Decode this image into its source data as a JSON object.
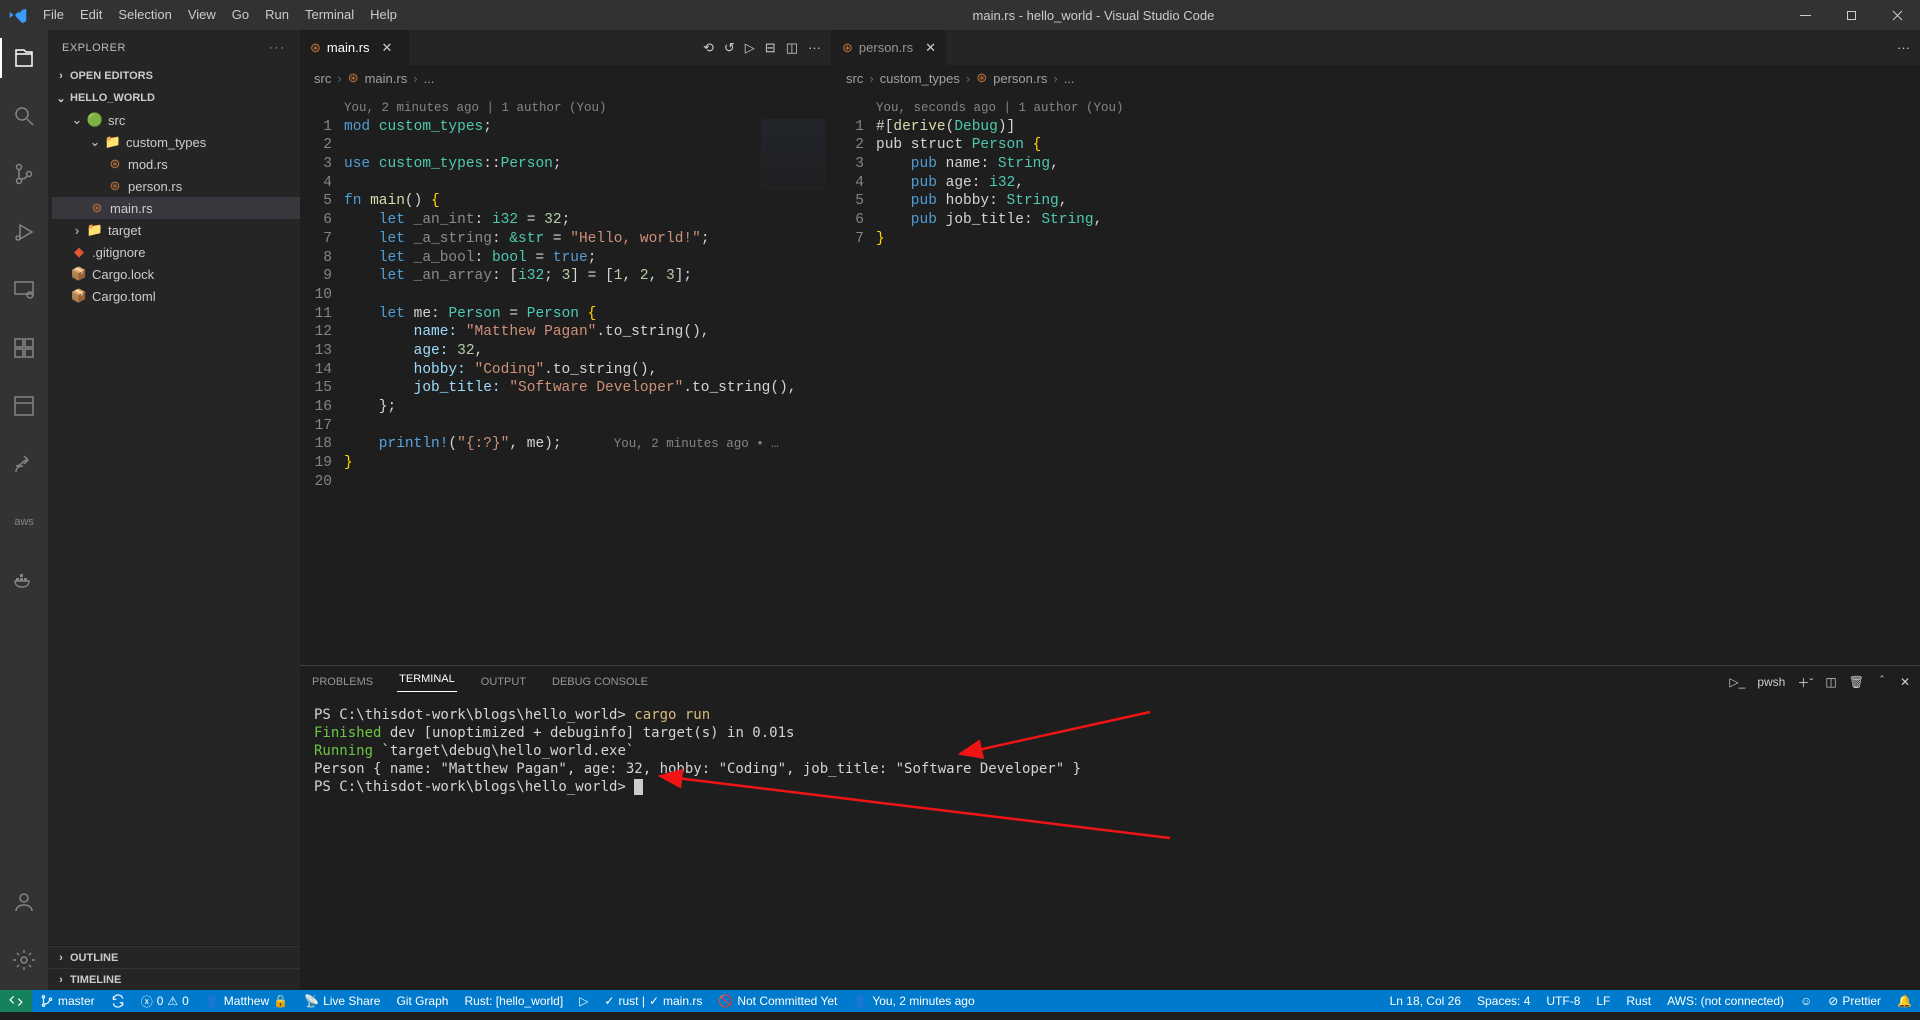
{
  "titlebar": {
    "title": "main.rs - hello_world - Visual Studio Code",
    "menus": [
      "File",
      "Edit",
      "Selection",
      "View",
      "Go",
      "Run",
      "Terminal",
      "Help"
    ]
  },
  "sidebar": {
    "title": "EXPLORER",
    "sections": {
      "openEditors": "OPEN EDITORS",
      "project": "HELLO_WORLD",
      "outline": "OUTLINE",
      "timeline": "TIMELINE"
    },
    "tree": {
      "src": "src",
      "custom_types": "custom_types",
      "mod_rs": "mod.rs",
      "person_rs": "person.rs",
      "main_rs": "main.rs",
      "target": "target",
      "gitignore": ".gitignore",
      "cargo_lock": "Cargo.lock",
      "cargo_toml": "Cargo.toml"
    }
  },
  "editor_left": {
    "tab_label": "main.rs",
    "breadcrumb": {
      "p1": "src",
      "p2": "main.rs",
      "p3": "..."
    },
    "codelens": "You, 2 minutes ago | 1 author (You)",
    "lines": {
      "1": [
        "mod ",
        "custom_types",
        ";"
      ],
      "2": "",
      "3": [
        "use ",
        "custom_types",
        "::",
        "Person",
        ";"
      ],
      "4": "",
      "5": [
        "fn ",
        "main",
        "() ",
        "{"
      ],
      "6": [
        "    let ",
        "_an_int",
        ": ",
        "i32",
        " = ",
        "32",
        ";"
      ],
      "7": [
        "    let ",
        "_a_string",
        ": ",
        "&str",
        " = ",
        "\"Hello, world!\"",
        ";"
      ],
      "8": [
        "    let ",
        "_a_bool",
        ": ",
        "bool",
        " = ",
        "true",
        ";"
      ],
      "9": [
        "    let ",
        "_an_array",
        ": [",
        "i32",
        "; ",
        "3",
        "] = [",
        "1",
        ", ",
        "2",
        ", ",
        "3",
        "];"
      ],
      "10": "",
      "11": [
        "    let ",
        "me",
        ": ",
        "Person",
        " = ",
        "Person",
        " {"
      ],
      "12": [
        "        name: ",
        "\"Matthew Pagan\"",
        ".to_string(),"
      ],
      "13": [
        "        age: ",
        "32",
        ","
      ],
      "14": [
        "        hobby: ",
        "\"Coding\"",
        ".to_string(),"
      ],
      "15": [
        "        job_title: ",
        "\"Software Developer\"",
        ".to_string(),"
      ],
      "16": "    };",
      "17": "",
      "18": [
        "    println!",
        "(",
        "\"{:?}\"",
        ",",
        " me",
        ");      ",
        "You, 2 minutes ago • …"
      ],
      "19": "}",
      "20": ""
    }
  },
  "editor_right": {
    "tab_label": "person.rs",
    "breadcrumb": {
      "p1": "src",
      "p2": "custom_types",
      "p3": "person.rs",
      "p4": "..."
    },
    "codelens": "You, seconds ago | 1 author (You)",
    "lines": {
      "1": [
        "#[",
        "derive",
        "(",
        "Debug",
        ")]"
      ],
      "2": [
        "pub struct ",
        "Person",
        " ",
        "{"
      ],
      "3": [
        "    pub ",
        "name",
        ": ",
        "String",
        ","
      ],
      "4": [
        "    pub ",
        "age",
        ": ",
        "i32",
        ","
      ],
      "5": [
        "    pub ",
        "hobby",
        ": ",
        "String",
        ","
      ],
      "6": [
        "    pub ",
        "job_title",
        ": ",
        "String",
        ","
      ],
      "7": "}"
    }
  },
  "panel": {
    "tabs": {
      "problems": "PROBLEMS",
      "terminal": "TERMINAL",
      "output": "OUTPUT",
      "debug": "DEBUG CONSOLE"
    },
    "shell_label": "pwsh",
    "terminal_lines": {
      "l1_prefix": "PS C:\\thisdot-work\\blogs\\hello_world> ",
      "l1_cmd": "cargo run",
      "l2_a": "    Finished",
      "l2_b": " dev [unoptimized + debuginfo] target(s) in 0.01s",
      "l3_a": "     Running",
      "l3_b": " `target\\debug\\hello_world.exe`",
      "l4": "Person { name: \"Matthew Pagan\", age: 32, hobby: \"Coding\", job_title: \"Software Developer\" }",
      "l5_prefix": "PS C:\\thisdot-work\\blogs\\hello_world> "
    }
  },
  "statusbar": {
    "branch": "master",
    "sync": "",
    "errors": "0",
    "warnings": "0",
    "user": "Matthew",
    "liveshare": "Live Share",
    "gitgraph": "Git Graph",
    "rust_ws": "Rust: [hello_world]",
    "rust_analyzer": "rust |",
    "target_main": "main.rs",
    "uncommitted": "Not Committed Yet",
    "blame": "You, 2 minutes ago",
    "cursor": "Ln 18, Col 26",
    "spaces": "Spaces: 4",
    "encoding": "UTF-8",
    "eol": "LF",
    "lang": "Rust",
    "aws": "AWS: (not connected)",
    "feedback": "",
    "prettier": "Prettier"
  }
}
